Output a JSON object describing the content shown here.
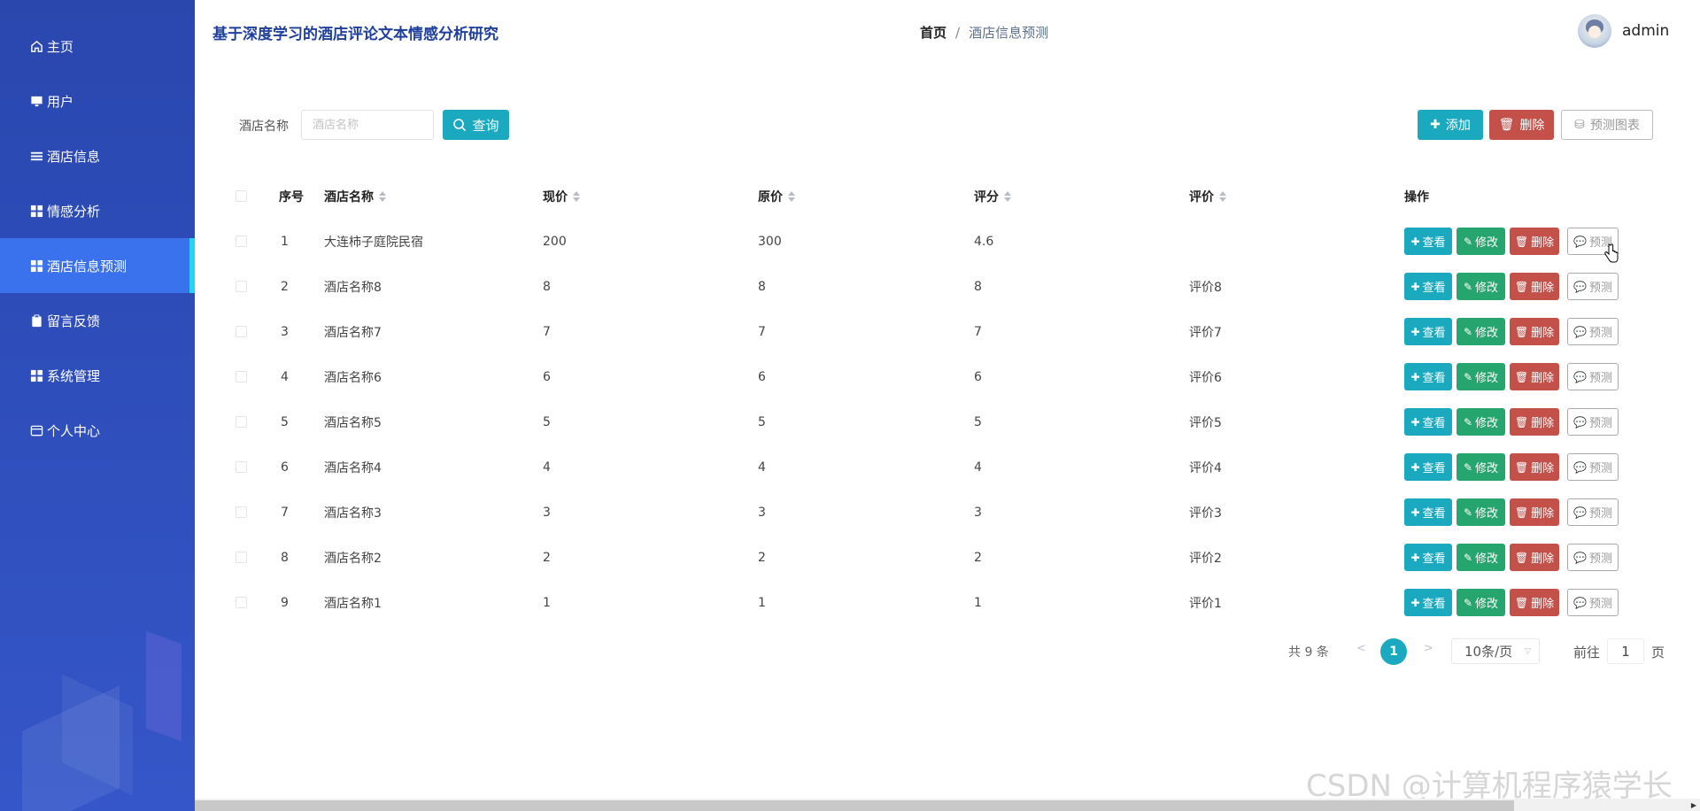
{
  "sidebar": {
    "items": [
      {
        "label": "主页",
        "icon": "home-icon"
      },
      {
        "label": "用户",
        "icon": "monitor-icon"
      },
      {
        "label": "酒店信息",
        "icon": "list-icon"
      },
      {
        "label": "情感分析",
        "icon": "grid-icon"
      },
      {
        "label": "酒店信息预测",
        "icon": "grid-icon",
        "active": true
      },
      {
        "label": "留言反馈",
        "icon": "clipboard-icon"
      },
      {
        "label": "系统管理",
        "icon": "grid-icon"
      },
      {
        "label": "个人中心",
        "icon": "card-icon"
      }
    ]
  },
  "header": {
    "title": "基于深度学习的酒店评论文本情感分析研究",
    "breadcrumb": {
      "home": "首页",
      "separator": "/",
      "current": "酒店信息预测"
    },
    "username": "admin"
  },
  "search": {
    "label": "酒店名称",
    "placeholder": "酒店名称",
    "value": "",
    "button": "查询"
  },
  "actions": {
    "add": "添加",
    "delete": "删除",
    "chart": "预测图表"
  },
  "table": {
    "columns": [
      "序号",
      "酒店名称",
      "现价",
      "原价",
      "评分",
      "评价",
      "操作"
    ],
    "rows": [
      {
        "no": "1",
        "name": "大连柿子庭院民宿",
        "price": "200",
        "original": "300",
        "score": "4.6",
        "review": ""
      },
      {
        "no": "2",
        "name": "酒店名称8",
        "price": "8",
        "original": "8",
        "score": "8",
        "review": "评价8"
      },
      {
        "no": "3",
        "name": "酒店名称7",
        "price": "7",
        "original": "7",
        "score": "7",
        "review": "评价7"
      },
      {
        "no": "4",
        "name": "酒店名称6",
        "price": "6",
        "original": "6",
        "score": "6",
        "review": "评价6"
      },
      {
        "no": "5",
        "name": "酒店名称5",
        "price": "5",
        "original": "5",
        "score": "5",
        "review": "评价5"
      },
      {
        "no": "6",
        "name": "酒店名称4",
        "price": "4",
        "original": "4",
        "score": "4",
        "review": "评价4"
      },
      {
        "no": "7",
        "name": "酒店名称3",
        "price": "3",
        "original": "3",
        "score": "3",
        "review": "评价3"
      },
      {
        "no": "8",
        "name": "酒店名称2",
        "price": "2",
        "original": "2",
        "score": "2",
        "review": "评价2"
      },
      {
        "no": "9",
        "name": "酒店名称1",
        "price": "1",
        "original": "1",
        "score": "1",
        "review": "评价1"
      }
    ],
    "row_actions": {
      "view": "查看",
      "edit": "修改",
      "delete": "删除",
      "predict": "预测"
    }
  },
  "pagination": {
    "total": "共 9 条",
    "prev": "<",
    "current": "1",
    "next": ">",
    "page_size": "10条/页",
    "goto_label": "前往",
    "goto_value": "1",
    "page_label": "页"
  },
  "watermark": "CSDN @计算机程序猿学长",
  "colors": {
    "sidebar": "#2f4fbd",
    "sidebar_active": "#3a72ee",
    "accent": "#1aa9bf",
    "success": "#26a56e",
    "danger": "#c4504a"
  }
}
